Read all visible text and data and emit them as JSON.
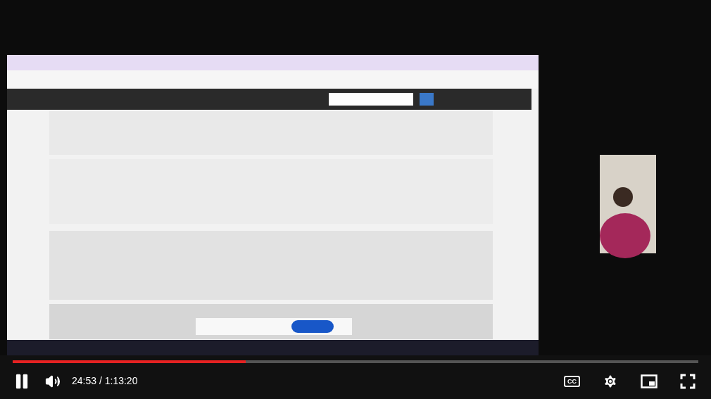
{
  "player": {
    "playing": true,
    "progress": {
      "level": 0.34
    },
    "time": "24:53 / 1:13:20",
    "captions": {
      "label": "CC",
      "on": false
    }
  }
}
